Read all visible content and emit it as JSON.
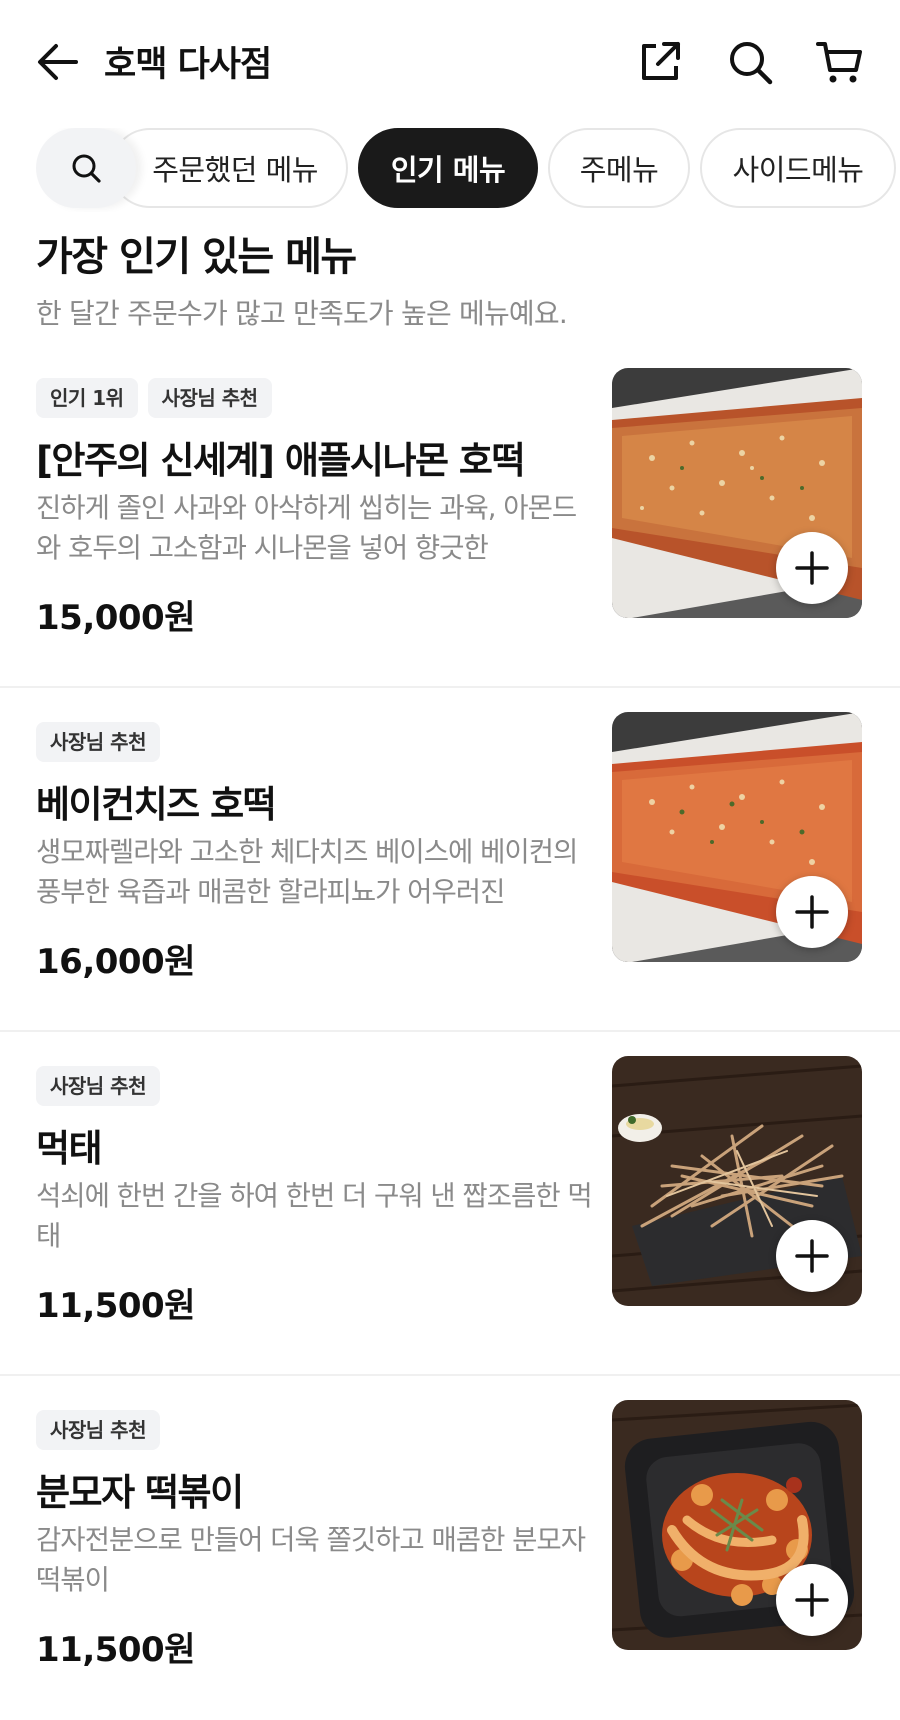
{
  "header": {
    "store_name": "호맥 다사점",
    "icons": [
      "back-arrow-icon",
      "share-icon",
      "search-icon",
      "cart-icon"
    ]
  },
  "chips": [
    {
      "label": "주문했던 메뉴",
      "active": false
    },
    {
      "label": "인기 메뉴",
      "active": true
    },
    {
      "label": "주메뉴",
      "active": false
    },
    {
      "label": "사이드메뉴",
      "active": false
    }
  ],
  "section": {
    "title": "가장 인기 있는 메뉴",
    "subtitle": "한 달간 주문수가 많고 만족도가 높은 메뉴예요."
  },
  "items": [
    {
      "badges": [
        "인기 1위",
        "사장님 추천"
      ],
      "name": "[안주의 신세계] 애플시나몬 호떡",
      "description": "진하게 졸인 사과와 아삭하게 씹히는 과육, 아몬드와 호두의 고소함과 시나몬을 넣어 향긋한",
      "price": "15,000원",
      "photo": "hotteok-photo"
    },
    {
      "badges": [
        "사장님 추천"
      ],
      "name": "베이컨치즈 호떡",
      "description": "생모짜렐라와 고소한 체다치즈 베이스에 베이컨의 풍부한 육즙과 매콤한 할라피뇨가 어우러진",
      "price": "16,000원",
      "photo": "hotteok-photo"
    },
    {
      "badges": [
        "사장님 추천"
      ],
      "name": "먹태",
      "description": "석쇠에 한번 간을 하여 한번 더 구워 낸 짭조름한 먹태",
      "price": "11,500원",
      "photo": "dried-pollack-photo"
    },
    {
      "badges": [
        "사장님 추천"
      ],
      "name": "분모자 떡볶이",
      "description": "감자전분으로 만들어 더욱 쫄깃하고 매콤한 분모자 떡볶이",
      "price": "11,500원",
      "photo": "tteokbokki-photo"
    }
  ],
  "colors": {
    "text_primary": "#111111",
    "text_secondary": "#8a8a8a",
    "chip_active_bg": "#1a1a1a",
    "badge_bg": "#f2f3f5"
  }
}
